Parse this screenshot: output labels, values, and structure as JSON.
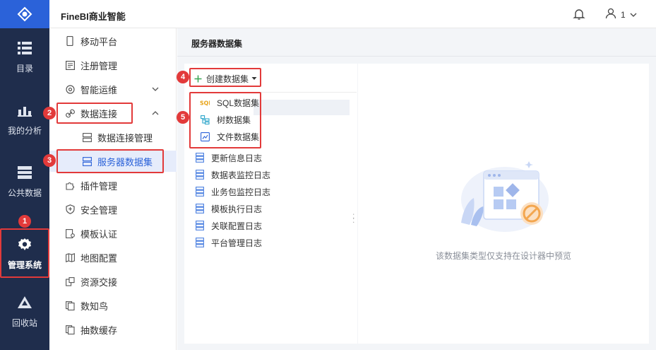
{
  "header": {
    "app_title": "FineBI商业智能",
    "user_label": "1",
    "icons": [
      "bell-icon",
      "user-icon",
      "chevron-down-icon"
    ]
  },
  "rail": {
    "items": [
      {
        "label": "目录",
        "icon": "catalog-icon"
      },
      {
        "label": "我的分析",
        "icon": "analysis-icon"
      },
      {
        "label": "公共数据",
        "icon": "public-data-icon"
      },
      {
        "label": "管理系统",
        "icon": "gear-icon",
        "active": true
      },
      {
        "label": "回收站",
        "icon": "recycle-icon"
      }
    ]
  },
  "nav": {
    "items": [
      {
        "label": "移动平台",
        "icon": "mobile-icon"
      },
      {
        "label": "注册管理",
        "icon": "register-icon"
      },
      {
        "label": "智能运维",
        "icon": "ops-icon",
        "expandable": "down"
      },
      {
        "label": "数据连接",
        "icon": "link-icon",
        "expandable": "up"
      },
      {
        "label": "数据连接管理",
        "icon": "server-icon",
        "sub": true
      },
      {
        "label": "服务器数据集",
        "icon": "server-dataset-icon",
        "sub": true,
        "selected": true
      },
      {
        "label": "插件管理",
        "icon": "plugin-icon"
      },
      {
        "label": "安全管理",
        "icon": "shield-icon"
      },
      {
        "label": "模板认证",
        "icon": "certificate-icon"
      },
      {
        "label": "地图配置",
        "icon": "map-icon"
      },
      {
        "label": "资源交接",
        "icon": "handover-icon"
      },
      {
        "label": "数知鸟",
        "icon": "bird-icon"
      },
      {
        "label": "抽数缓存",
        "icon": "cache-icon"
      }
    ]
  },
  "main": {
    "page_title": "服务器数据集",
    "create_button": "创建数据集",
    "create_menu": [
      {
        "label": "SQL数据集",
        "icon": "sql-icon"
      },
      {
        "label": "树数据集",
        "icon": "tree-icon"
      },
      {
        "label": "文件数据集",
        "icon": "file-icon"
      }
    ],
    "logs": [
      "更新信息日志",
      "数据表监控日志",
      "业务包监控日志",
      "模板执行日志",
      "关联配置日志",
      "平台管理日志"
    ],
    "empty_text": "该数据集类型仅支持在设计器中预览"
  },
  "badges": [
    "1",
    "2",
    "3",
    "4",
    "5"
  ],
  "colors": {
    "accent": "#2b62d9",
    "rail_bg": "#1f2d4c",
    "annotation": "#e23a3a"
  }
}
